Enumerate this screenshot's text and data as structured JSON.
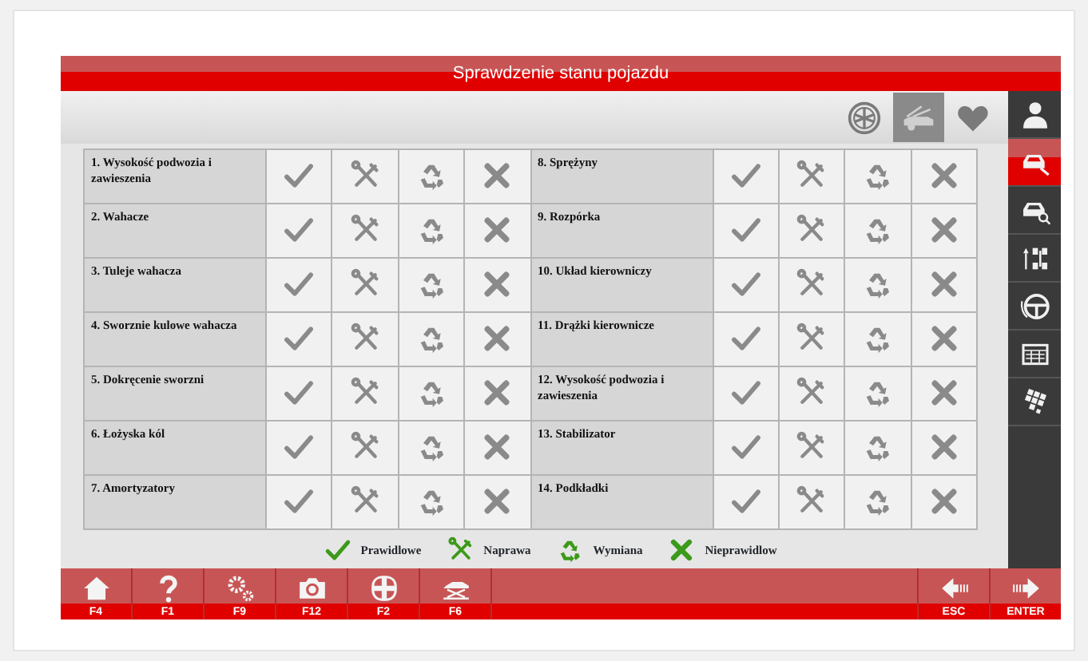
{
  "window": {
    "title": "Sprawdzenie stanu pojazdu"
  },
  "toolbar": [
    {
      "kind": "wheel",
      "selected": false
    },
    {
      "kind": "car-hood",
      "selected": true
    },
    {
      "kind": "heart",
      "selected": false
    }
  ],
  "sidebar": [
    {
      "kind": "mechanic",
      "selected": false
    },
    {
      "kind": "car-wrench",
      "selected": true
    },
    {
      "kind": "car-search",
      "selected": false
    },
    {
      "kind": "axles",
      "selected": false
    },
    {
      "kind": "steering",
      "selected": false
    },
    {
      "kind": "grid",
      "selected": false
    },
    {
      "kind": "tiles",
      "selected": false
    }
  ],
  "items": [
    {
      "label": "1. Wysokość podwozia i zawieszenia"
    },
    {
      "label": "2. Wahacze"
    },
    {
      "label": "3. Tuleje wahacza"
    },
    {
      "label": "4. Sworznie kulowe wahacza"
    },
    {
      "label": "5. Dokręcenie sworzni"
    },
    {
      "label": "6. Łożyska kól"
    },
    {
      "label": "7. Amortyzatory"
    },
    {
      "label": "8. Sprężyny"
    },
    {
      "label": "9. Rozpórka"
    },
    {
      "label": "10. Układ kierowniczy"
    },
    {
      "label": "11. Drążki kierownicze"
    },
    {
      "label": "12. Wysokość podwozia i zawieszenia"
    },
    {
      "label": "13. Stabilizator"
    },
    {
      "label": "14. Podkładki"
    }
  ],
  "legend": [
    {
      "kind": "ok",
      "label": "Prawidlowe"
    },
    {
      "kind": "repair",
      "label": "Naprawa"
    },
    {
      "kind": "replace",
      "label": "Wymiana"
    },
    {
      "kind": "wrong",
      "label": "Nieprawidlow"
    }
  ],
  "function_keys": [
    {
      "kind": "home",
      "label": "F4"
    },
    {
      "kind": "help",
      "label": "F1"
    },
    {
      "kind": "gears",
      "label": "F9"
    },
    {
      "kind": "camera",
      "label": "F12"
    },
    {
      "kind": "petals",
      "label": "F2"
    },
    {
      "kind": "lift",
      "label": "F6"
    }
  ],
  "nav_keys": [
    {
      "kind": "back",
      "label": "ESC"
    },
    {
      "kind": "forward",
      "label": "ENTER"
    }
  ]
}
